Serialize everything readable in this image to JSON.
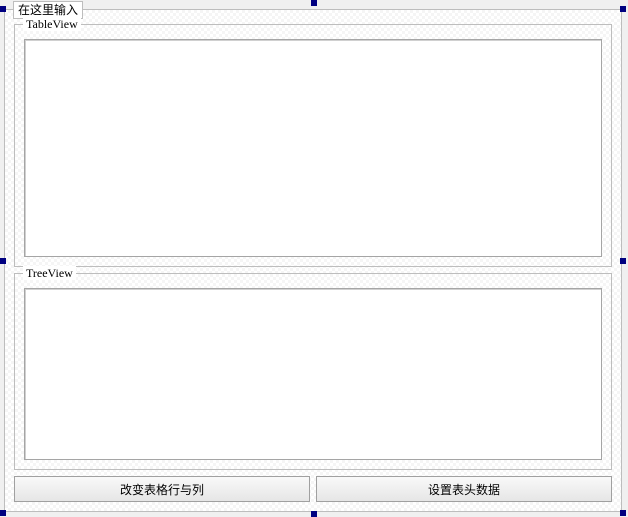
{
  "outer_group": {
    "title": "在这里输入"
  },
  "group_table": {
    "title": "TableView"
  },
  "group_tree": {
    "title": "TreeView"
  },
  "buttons": {
    "change_rows_cols": "改变表格行与列",
    "set_header_data": "设置表头数据"
  }
}
